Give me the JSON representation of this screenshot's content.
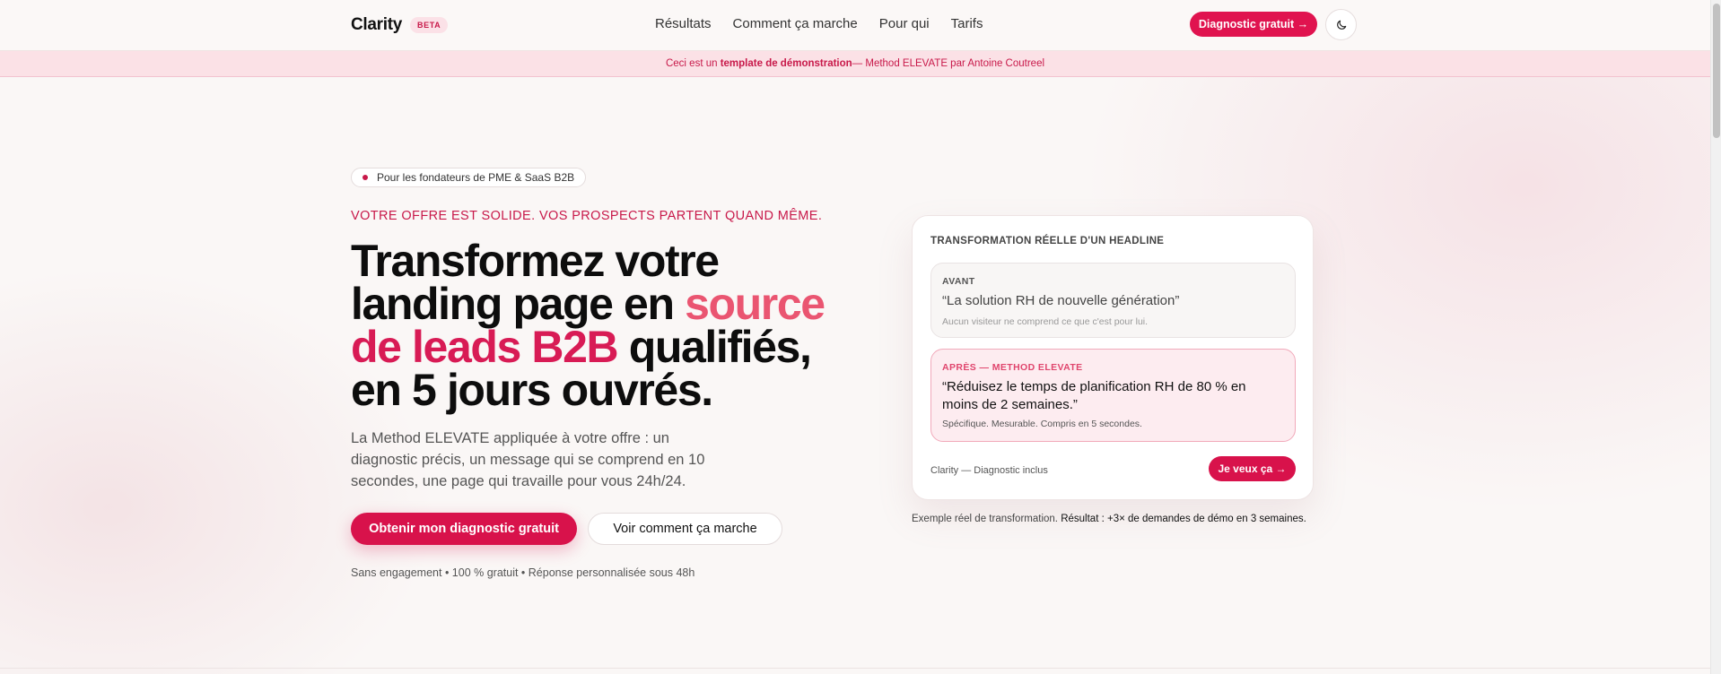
{
  "header": {
    "brand": "Clarity",
    "badge": "BETA",
    "nav": [
      "Résultats",
      "Comment ça marche",
      "Pour qui",
      "Tarifs"
    ],
    "cta": "Diagnostic gratuit →",
    "theme_toggle_icon": "moon-icon"
  },
  "banner": {
    "prefix": "Ceci est un ",
    "bold": "template de démonstration",
    "suffix": " — Method ELEVATE par Antoine Coutreel"
  },
  "hero": {
    "pill": "Pour les fondateurs de PME & SaaS B2B",
    "eyebrow": "VOTRE OFFRE EST SOLIDE. VOS PROSPECTS PARTENT QUAND MÊME.",
    "headline_part1": "Transformez votre landing page en ",
    "headline_accent_a": "source",
    "headline_accent_b": "de leads B2B",
    "headline_part2": " qualifiés, en 5 jours ouvrés.",
    "subtitle": "La Method ELEVATE appliquée à votre offre : un diagnostic précis, un message qui se comprend en 10 secondes, une page qui travaille pour vous 24h/24.",
    "primary_cta": "Obtenir mon diagnostic gratuit",
    "secondary_cta": "Voir comment ça marche",
    "reassurance": "Sans engagement • 100 % gratuit • Réponse personnalisée sous 48h"
  },
  "card": {
    "title": "TRANSFORMATION RÉELLE D'UN HEADLINE",
    "before_label": "AVANT",
    "before_quote": "“La solution RH de nouvelle génération”",
    "before_note": "Aucun visiteur ne comprend ce que c'est pour lui.",
    "after_label": "APRÈS — METHOD ELEVATE",
    "after_quote": "“Réduisez le temps de planification RH de 80 % en moins de 2 semaines.”",
    "after_note": "Spécifique. Mesurable. Compris en 5 secondes.",
    "footer_text": "Clarity — Diagnostic inclus",
    "cta": "Je veux ça →"
  },
  "caption": {
    "prefix": "Exemple réel de transformation. ",
    "bold": "Résultat : +3× de demandes de démo en 3 semaines."
  },
  "colors": {
    "accent": "#d8124b",
    "accent_light": "#ea5571",
    "banner_bg": "#fbe1e6"
  }
}
